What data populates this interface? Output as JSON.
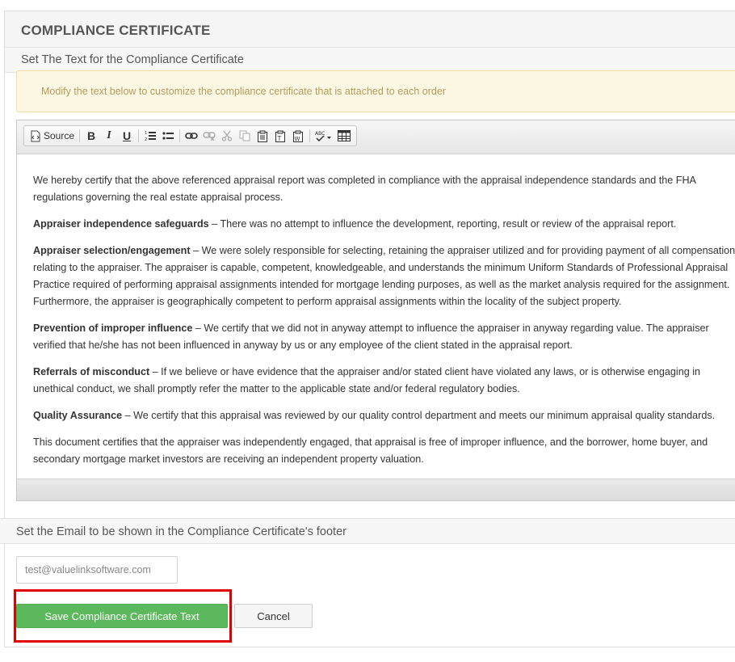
{
  "header": {
    "title": "COMPLIANCE CERTIFICATE"
  },
  "text_section": {
    "title": "Set The Text for the Compliance Certificate"
  },
  "notice": {
    "text": "Modify the text below to customize the compliance certificate that is attached to each order"
  },
  "toolbar": {
    "source_label": "Source",
    "bold": "B",
    "italic": "I",
    "underline": "U"
  },
  "certificate": {
    "intro": "We hereby certify that the above referenced appraisal report was completed in compliance with the appraisal independence standards and the FHA regulations governing the real estate appraisal process.",
    "paragraphs": [
      {
        "heading": "Appraiser independence safeguards",
        "text": " – There was no attempt to influence the development, reporting, result or review of the appraisal report."
      },
      {
        "heading": "Appraiser selection/engagement",
        "text": " – We were solely responsible for selecting, retaining the appraiser utilized and for providing payment of all compensation relating to the appraiser. The appraiser is capable, competent, knowledgeable, and understands the minimum Uniform Standards of Professional Appraisal Practice required of performing appraisal assignments intended for mortgage lending purposes, as well as the market analysis required for the assignment. Furthermore, the appraiser is geographically competent to perform appraisal assignments within the locality of the subject property."
      },
      {
        "heading": "Prevention of improper influence",
        "text": " – We certify that we did not in anyway attempt to influence the appraiser in anyway regarding value. The appraiser verified that he/she has not been influenced in anyway by us or any employee of the client stated in the appraisal report."
      },
      {
        "heading": "Referrals of misconduct",
        "text": " – If we believe or have evidence that the appraiser and/or stated client have violated any laws, or is otherwise engaging in unethical conduct, we shall promptly refer the matter to the applicable state and/or federal regulatory bodies."
      },
      {
        "heading": "Quality Assurance",
        "text": " – We certify that this appraisal was reviewed by our quality control department and meets our minimum appraisal quality standards."
      }
    ],
    "closing": "This document certifies that the appraiser was independently engaged, that appraisal is free of improper influence, and the borrower, home buyer, and secondary mortgage market investors are receiving an independent property valuation."
  },
  "email_section": {
    "title": "Set the Email to be shown in the Compliance Certificate's footer",
    "email_value": "test@valuelinksoftware.com"
  },
  "actions": {
    "save_label": "Save Compliance Certificate Text",
    "cancel_label": "Cancel"
  },
  "colors": {
    "save_green": "#5cb85c",
    "highlight_red": "#e00000",
    "notice_bg": "#fcf8e3"
  }
}
